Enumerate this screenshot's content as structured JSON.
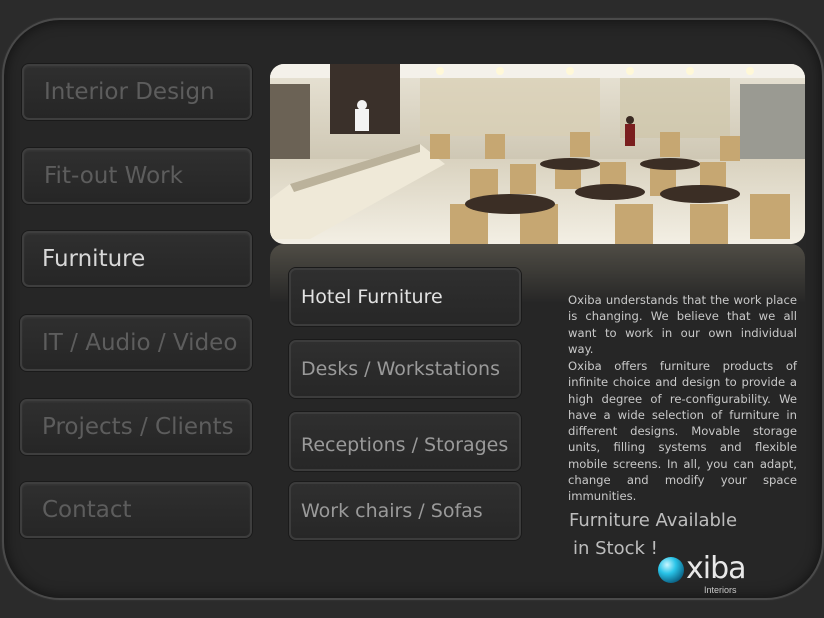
{
  "nav": {
    "items": [
      {
        "label": "Interior Design",
        "active": false
      },
      {
        "label": "Fit-out  Work",
        "active": false
      },
      {
        "label": "Furniture",
        "active": true
      },
      {
        "label": "IT / Audio / Video",
        "active": false
      },
      {
        "label": "Projects / Clients",
        "active": false
      },
      {
        "label": "Contact",
        "active": false
      }
    ]
  },
  "furniture_menu": {
    "items": [
      {
        "label": "Hotel Furniture",
        "active": true
      },
      {
        "label": "Desks  / Workstations",
        "active": false
      },
      {
        "label": "Receptions  /  Storages",
        "active": false
      },
      {
        "label": "Work chairs  / Sofas",
        "active": false
      }
    ]
  },
  "description": {
    "paragraph1": "Oxiba understands that the work place is changing. We believe that we all want to work  in our own individual way.",
    "paragraph2": "Oxiba offers furniture products of infinite choice and design to provide a high degree of re-configurability. We have a wide selection of furniture in different designs. Movable storage units, filling systems and flexible mobile screens. In all, you can adapt, change and modify your  space immunities."
  },
  "stock": {
    "line1": "Furniture Available",
    "line2": "in Stock !"
  },
  "logo": {
    "name": "xiba",
    "subtitle": "Interiors"
  },
  "colors": {
    "background": "#2b2b2b",
    "panel": "#262626",
    "nav_inactive_text": "#5d5d5d",
    "nav_active_text": "#d8d8d8",
    "logo_accent": "#29c4e8"
  },
  "images": {
    "hero": "restaurant-dining-hall-photo"
  }
}
